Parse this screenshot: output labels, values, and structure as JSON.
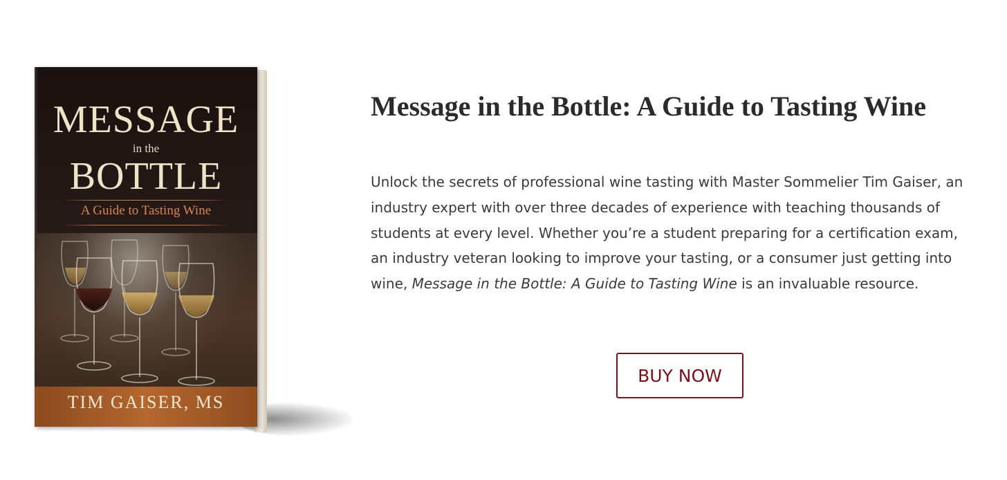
{
  "book": {
    "title_line1": "MESSAGE",
    "title_line2": "in the",
    "title_line3": "BOTTLE",
    "subtitle": "A Guide to Tasting Wine",
    "author": "TIM GAISER, MS"
  },
  "main": {
    "heading": "Message in the Bottle: A Guide to Tasting Wine",
    "description_part1": "Unlock the secrets of professional wine tasting with Master Sommelier Tim Gaiser, an industry expert with over three decades of experience with teaching thousands of students at every level. Whether you’re a student preparing for a certification exam, an industry veteran looking to improve your tasting, or a consumer just getting into wine, ",
    "description_italic": "Message in the Bottle: A Guide to Tasting Wine",
    "description_part2": " is an invaluable resource.",
    "buy_label": "BUY NOW"
  },
  "colors": {
    "accent": "#7a1118",
    "heading": "#2b2b2b",
    "body_text": "#3a3a3a"
  }
}
